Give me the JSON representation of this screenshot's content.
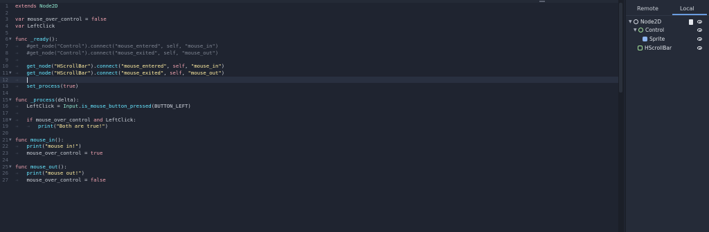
{
  "editor": {
    "lines": [
      {
        "n": "1",
        "fold": false,
        "html": "<span class=\"kw\">extends</span> <span class=\"cls\">Node2D</span>"
      },
      {
        "n": "2",
        "fold": false,
        "html": ""
      },
      {
        "n": "3",
        "fold": false,
        "html": "<span class=\"kw\">var</span> mouse_over_control = <span class=\"kw\">false</span>"
      },
      {
        "n": "4",
        "fold": false,
        "html": "<span class=\"kw\">var</span> LeftClick"
      },
      {
        "n": "5",
        "fold": false,
        "html": ""
      },
      {
        "n": "6",
        "fold": true,
        "html": "<span class=\"kw\">func</span> <span class=\"fn\">_ready</span>():"
      },
      {
        "n": "7",
        "fold": false,
        "html": "<span class=\"tab\">⇥</span><span class=\"cm\">#get_node(\"Control\").connect(\"mouse_entered\", self, \"mouse_in\")</span>"
      },
      {
        "n": "8",
        "fold": false,
        "html": "<span class=\"tab\">⇥</span><span class=\"cm\">#get_node(\"Control\").connect(\"mouse_exited\", self, \"mouse_out\")</span>"
      },
      {
        "n": "9",
        "fold": false,
        "html": "<span class=\"tab\">⇥</span>"
      },
      {
        "n": "10",
        "fold": false,
        "html": "<span class=\"tab\">⇥</span><span class=\"fn\">get_node</span>(<span class=\"str\">\"HScrollBar\"</span>).<span class=\"fn\">connect</span>(<span class=\"str\">\"mouse_entered\"</span>, <span class=\"kw\">self</span>, <span class=\"str\">\"mouse_in\"</span>)"
      },
      {
        "n": "11",
        "fold": true,
        "html": "<span class=\"tab\">⇥</span><span class=\"fn\">get_node</span>(<span class=\"str\">\"HScrollBar\"</span>).<span class=\"fn\">connect</span>(<span class=\"str\">\"mouse_exited\"</span>, <span class=\"kw\">self</span>, <span class=\"str\">\"mouse_out\"</span>)"
      },
      {
        "n": "12",
        "fold": false,
        "cur": true,
        "html": "<span class=\"tab\">⇥</span><span class=\"cursorbar\"></span>"
      },
      {
        "n": "13",
        "fold": false,
        "html": "<span class=\"tab\">⇥</span><span class=\"fn\">set_process</span>(<span class=\"kw\">true</span>)"
      },
      {
        "n": "14",
        "fold": false,
        "html": ""
      },
      {
        "n": "15",
        "fold": true,
        "html": "<span class=\"kw\">func</span> <span class=\"fn\">_process</span>(delta):"
      },
      {
        "n": "16",
        "fold": false,
        "html": "<span class=\"tab\">⇥</span>LeftClick = <span class=\"cls\">Input</span>.<span class=\"fn\">is_mouse_button_pressed</span>(BUTTON_LEFT)"
      },
      {
        "n": "17",
        "fold": false,
        "html": "<span class=\"tab\">⇥</span>"
      },
      {
        "n": "18",
        "fold": true,
        "html": "<span class=\"tab\">⇥</span><span class=\"kw\">if</span> mouse_over_control <span class=\"kw\">and</span> LeftClick:"
      },
      {
        "n": "19",
        "fold": false,
        "html": "<span class=\"tab\">⇥</span><span class=\"tab\">⇥</span><span class=\"fn\">print</span>(<span class=\"str\">\"Both are true!\"</span>)"
      },
      {
        "n": "20",
        "fold": false,
        "html": ""
      },
      {
        "n": "21",
        "fold": true,
        "html": "<span class=\"kw\">func</span> <span class=\"fn\">mouse_in</span>():"
      },
      {
        "n": "22",
        "fold": false,
        "html": "<span class=\"tab\">⇥</span><span class=\"fn\">print</span>(<span class=\"str\">\"mouse in!\"</span>)"
      },
      {
        "n": "23",
        "fold": false,
        "html": "<span class=\"tab\">⇥</span>mouse_over_control = <span class=\"kw\">true</span>"
      },
      {
        "n": "24",
        "fold": false,
        "html": ""
      },
      {
        "n": "25",
        "fold": true,
        "html": "<span class=\"kw\">func</span> <span class=\"fn\">mouse_out</span>():"
      },
      {
        "n": "26",
        "fold": false,
        "html": "<span class=\"tab\">⇥</span><span class=\"fn\">print</span>(<span class=\"str\">\"mouse out!\"</span>)"
      },
      {
        "n": "27",
        "fold": false,
        "html": "<span class=\"tab\">⇥</span>mouse_over_control = <span class=\"kw\">false</span>"
      }
    ]
  },
  "scene_panel": {
    "tabs": {
      "remote": "Remote",
      "local": "Local"
    },
    "nodes": [
      {
        "label": "Node2D",
        "icon": "node2d-icon"
      },
      {
        "label": "Control",
        "icon": "control-icon"
      },
      {
        "label": "Sprite",
        "icon": "sprite-icon"
      },
      {
        "label": "HScrollBar",
        "icon": "hscrollbar-icon"
      }
    ]
  }
}
